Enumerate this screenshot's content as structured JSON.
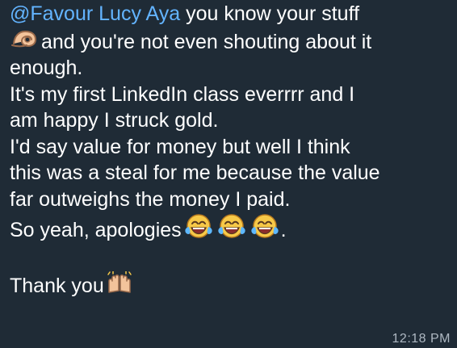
{
  "message": {
    "mention": "@Favour Lucy Aya",
    "line1_rest": " you know your stuff",
    "line2": "and you're not even shouting about it",
    "line3": "enough.",
    "line4": "It's my first LinkedIn class everrrr and I",
    "line5": "am happy I struck gold.",
    "line6": "I'd say value for money but well I think",
    "line7": "this was a steal for me because the value",
    "line8": "far outweighs the money I paid.",
    "line9": "So yeah, apologies",
    "line9_end": ".",
    "line10": "Thank you",
    "timestamp": "12:18 PM"
  },
  "colors": {
    "background": "#1f2b36",
    "text": "#ffffff",
    "mention": "#63b4ff",
    "timestamp": "#aeb8c2"
  },
  "icons": {
    "ok_hand": "ok-hand-icon",
    "tears_of_joy": "tears-of-joy-icon",
    "raised_hands": "raised-hands-icon"
  }
}
